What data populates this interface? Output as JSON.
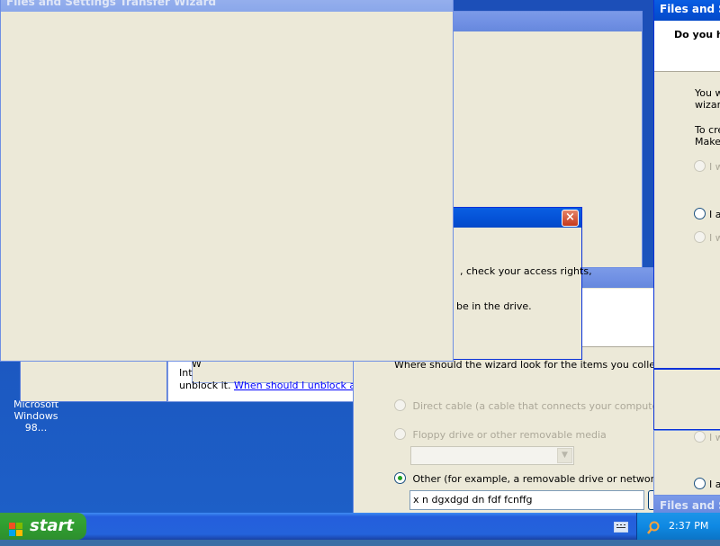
{
  "desktop": {
    "icon_label_line1": "Microsoft",
    "icon_label_line2": "Windows 98..."
  },
  "windows": {
    "main_wizard_title": "Files and Settings Transfer Wizard",
    "right_wizard_title": "Files and S",
    "right_wizard_question": "Do you h",
    "right_wizard_text1_line1": "You w",
    "right_wizard_text1_line2": "wizard",
    "right_wizard_text2_line1": "To cre",
    "right_wizard_text2_line2": "Make",
    "right_wizard_option1": "I w",
    "right_wizard_option2": "I a",
    "right_wizard_option3": "I w",
    "right_wizard_option4": "I w",
    "right_wizard_option5": "I a",
    "bottom_right_title": "Files and S",
    "error_dialog_line1": ", check your access rights,",
    "error_dialog_line2": "be in the drive.",
    "help_text_fragment1": "W",
    "help_text_fragment2": "Int",
    "help_text_unblock": "unblock it.",
    "help_text_link": "When should I unblock a program"
  },
  "collect_dialog": {
    "question": "Where should the wizard look for the items you collected?",
    "option_direct_cable": "Direct cable (a cable that connects your computers' serial",
    "option_floppy": "Floppy drive or other removable media",
    "option_other": "Other (for example, a removable drive or network drive)",
    "path_value": "x n dgxdgd dn fdf fcnffg",
    "selected_option": "other"
  },
  "taskbar": {
    "start_label": "start",
    "clock": "2:37 PM"
  },
  "colors": {
    "title_active": "#0553d8",
    "title_inactive": "#7b9ae8",
    "window_face": "#ece9d8",
    "desktop": "#1c4fb8",
    "start_green": "#32a232"
  }
}
